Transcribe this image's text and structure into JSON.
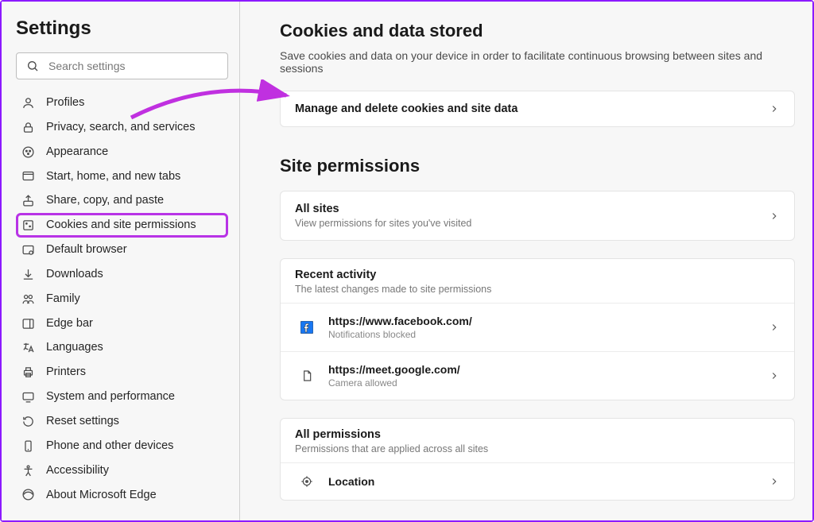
{
  "page_title": "Settings",
  "search": {
    "placeholder": "Search settings"
  },
  "sidebar": {
    "items": [
      {
        "label": "Profiles"
      },
      {
        "label": "Privacy, search, and services"
      },
      {
        "label": "Appearance"
      },
      {
        "label": "Start, home, and new tabs"
      },
      {
        "label": "Share, copy, and paste"
      },
      {
        "label": "Cookies and site permissions"
      },
      {
        "label": "Default browser"
      },
      {
        "label": "Downloads"
      },
      {
        "label": "Family"
      },
      {
        "label": "Edge bar"
      },
      {
        "label": "Languages"
      },
      {
        "label": "Printers"
      },
      {
        "label": "System and performance"
      },
      {
        "label": "Reset settings"
      },
      {
        "label": "Phone and other devices"
      },
      {
        "label": "Accessibility"
      },
      {
        "label": "About Microsoft Edge"
      }
    ]
  },
  "main": {
    "cookies": {
      "title": "Cookies and data stored",
      "subtitle": "Save cookies and data on your device in order to facilitate continuous browsing between sites and sessions",
      "manage_row": "Manage and delete cookies and site data"
    },
    "site_permissions": {
      "title": "Site permissions",
      "all_sites": {
        "title": "All sites",
        "desc": "View permissions for sites you've visited"
      },
      "recent": {
        "title": "Recent activity",
        "desc": "The latest changes made to site permissions",
        "items": [
          {
            "url": "https://www.facebook.com/",
            "status": "Notifications blocked",
            "icon": "facebook"
          },
          {
            "url": "https://meet.google.com/",
            "status": "Camera allowed",
            "icon": "file"
          }
        ]
      },
      "all_permissions": {
        "title": "All permissions",
        "desc": "Permissions that are applied across all sites",
        "items": [
          {
            "label": "Location"
          }
        ]
      }
    }
  }
}
